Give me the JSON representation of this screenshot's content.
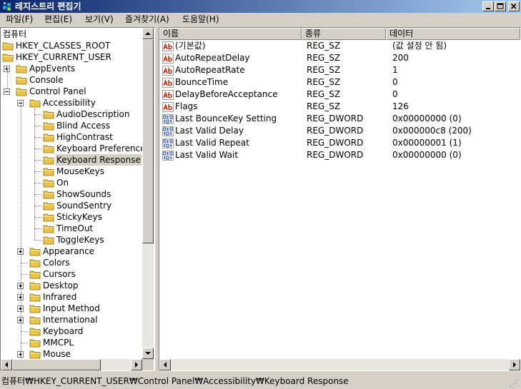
{
  "window": {
    "title": "레지스트리 편집기",
    "minimize": "_",
    "maximize": "□",
    "close": "×"
  },
  "menu": [
    "파일(F)",
    "편집(E)",
    "보기(V)",
    "즐겨찾기(A)",
    "도움말(H)"
  ],
  "tree": {
    "root": "컴퓨터",
    "items": [
      {
        "label": "HKEY_CLASSES_ROOT",
        "depth": 0,
        "expander": "none"
      },
      {
        "label": "HKEY_CURRENT_USER",
        "depth": 0,
        "expander": "none"
      },
      {
        "label": "AppEvents",
        "depth": 1,
        "expander": "plus"
      },
      {
        "label": "Console",
        "depth": 1,
        "expander": "none"
      },
      {
        "label": "Control Panel",
        "depth": 1,
        "expander": "minus"
      },
      {
        "label": "Accessibility",
        "depth": 2,
        "expander": "minus"
      },
      {
        "label": "AudioDescription",
        "depth": 3,
        "expander": "none"
      },
      {
        "label": "Blind Access",
        "depth": 3,
        "expander": "none"
      },
      {
        "label": "HighContrast",
        "depth": 3,
        "expander": "none"
      },
      {
        "label": "Keyboard Preference",
        "depth": 3,
        "expander": "none"
      },
      {
        "label": "Keyboard Response",
        "depth": 3,
        "expander": "none",
        "selected": true
      },
      {
        "label": "MouseKeys",
        "depth": 3,
        "expander": "none"
      },
      {
        "label": "On",
        "depth": 3,
        "expander": "none"
      },
      {
        "label": "ShowSounds",
        "depth": 3,
        "expander": "none"
      },
      {
        "label": "SoundSentry",
        "depth": 3,
        "expander": "none"
      },
      {
        "label": "StickyKeys",
        "depth": 3,
        "expander": "none"
      },
      {
        "label": "TimeOut",
        "depth": 3,
        "expander": "none"
      },
      {
        "label": "ToggleKeys",
        "depth": 3,
        "expander": "none"
      },
      {
        "label": "Appearance",
        "depth": 2,
        "expander": "plus"
      },
      {
        "label": "Colors",
        "depth": 2,
        "expander": "none"
      },
      {
        "label": "Cursors",
        "depth": 2,
        "expander": "none"
      },
      {
        "label": "Desktop",
        "depth": 2,
        "expander": "plus"
      },
      {
        "label": "Infrared",
        "depth": 2,
        "expander": "plus"
      },
      {
        "label": "Input Method",
        "depth": 2,
        "expander": "plus"
      },
      {
        "label": "International",
        "depth": 2,
        "expander": "plus"
      },
      {
        "label": "Keyboard",
        "depth": 2,
        "expander": "none"
      },
      {
        "label": "MMCPL",
        "depth": 2,
        "expander": "none"
      },
      {
        "label": "Mouse",
        "depth": 2,
        "expander": "plus"
      }
    ]
  },
  "list": {
    "columns": [
      "이름",
      "종류",
      "데이터"
    ],
    "rows": [
      {
        "icon": "string-value-icon",
        "name": "(기본값)",
        "type": "REG_SZ",
        "data": "(값 설정 안 됨)"
      },
      {
        "icon": "string-value-icon",
        "name": "AutoRepeatDelay",
        "type": "REG_SZ",
        "data": "200"
      },
      {
        "icon": "string-value-icon",
        "name": "AutoRepeatRate",
        "type": "REG_SZ",
        "data": "1"
      },
      {
        "icon": "string-value-icon",
        "name": "BounceTime",
        "type": "REG_SZ",
        "data": "0"
      },
      {
        "icon": "string-value-icon",
        "name": "DelayBeforeAcceptance",
        "type": "REG_SZ",
        "data": "0"
      },
      {
        "icon": "string-value-icon",
        "name": "Flags",
        "type": "REG_SZ",
        "data": "126"
      },
      {
        "icon": "binary-value-icon",
        "name": "Last BounceKey Setting",
        "type": "REG_DWORD",
        "data": "0x00000000 (0)"
      },
      {
        "icon": "binary-value-icon",
        "name": "Last Valid Delay",
        "type": "REG_DWORD",
        "data": "0x000000c8 (200)"
      },
      {
        "icon": "binary-value-icon",
        "name": "Last Valid Repeat",
        "type": "REG_DWORD",
        "data": "0x00000001 (1)"
      },
      {
        "icon": "binary-value-icon",
        "name": "Last Valid Wait",
        "type": "REG_DWORD",
        "data": "0x00000000 (0)"
      }
    ]
  },
  "status": "컴퓨터₩HKEY_CURRENT_USER₩Control Panel₩Accessibility₩Keyboard Response",
  "colors": {
    "title_start": "#0a246a",
    "title_end": "#a6caf0",
    "folder": "#e8c44a",
    "string_icon": "#cc2200",
    "binary_icon": "#1a3fa8"
  }
}
